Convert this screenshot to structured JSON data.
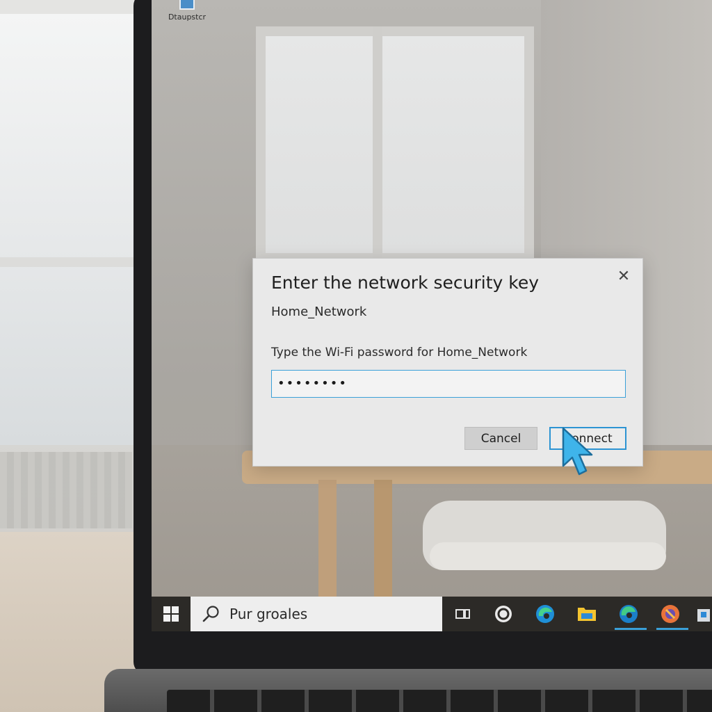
{
  "desktop": {
    "icon_label": "Dtaupstcr"
  },
  "dialog": {
    "title": "Enter the network security key",
    "network_name": "Home_Network",
    "prompt": "Type the Wi-Fi password for Home_Network",
    "password_value": "••••••••",
    "close_glyph": "✕",
    "cancel_label": "Cancel",
    "connect_label": "Connect"
  },
  "taskbar": {
    "search_text": "Pur groales",
    "icons": [
      "windows-start-icon",
      "search-icon",
      "task-view-icon",
      "cortana-icon",
      "edge-icon",
      "file-explorer-icon",
      "edge-pinned-icon",
      "firefox-icon",
      "store-icon"
    ]
  },
  "colors": {
    "accent": "#2c94d3",
    "dialog_bg": "#e9e9e9",
    "taskbar_bg": "#2c2a27"
  }
}
